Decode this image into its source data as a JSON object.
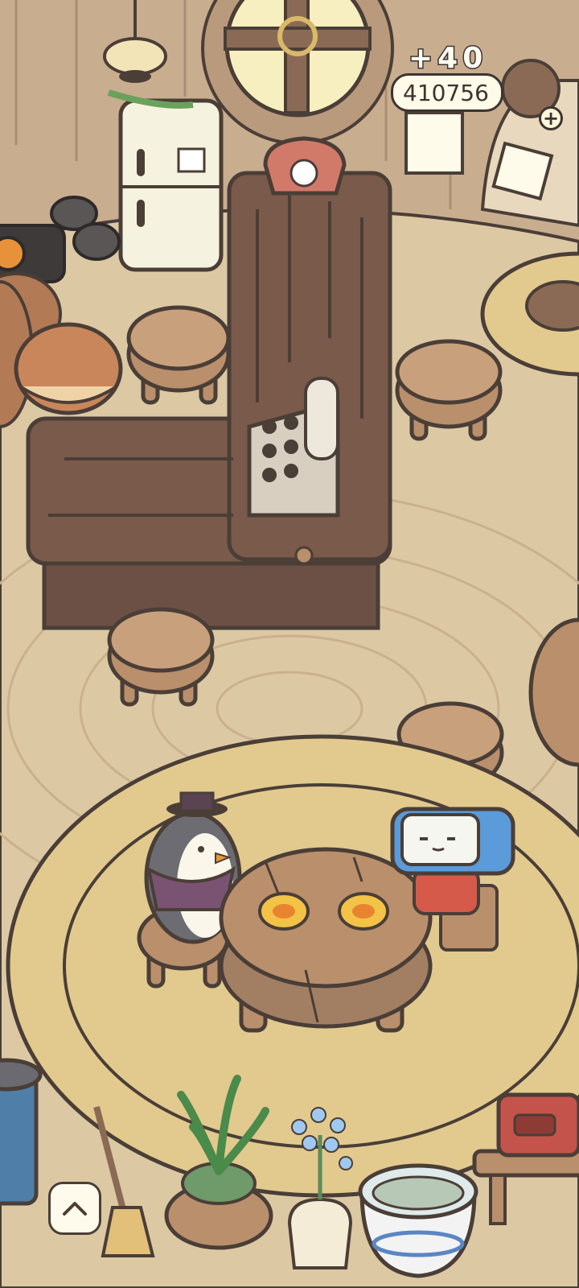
{
  "hud": {
    "coin_gain": "+40",
    "coin_total": "410756"
  },
  "controls": {
    "add_icon": "plus-icon",
    "scroll_up_icon": "chevron-up-icon"
  },
  "colors": {
    "floor": "#dcc9a4",
    "wall": "#c9ad8f",
    "rug": "#e2c98e",
    "wood_dark": "#7a5a4a",
    "outline": "#4a3e37",
    "stool": "#b98f6c"
  }
}
